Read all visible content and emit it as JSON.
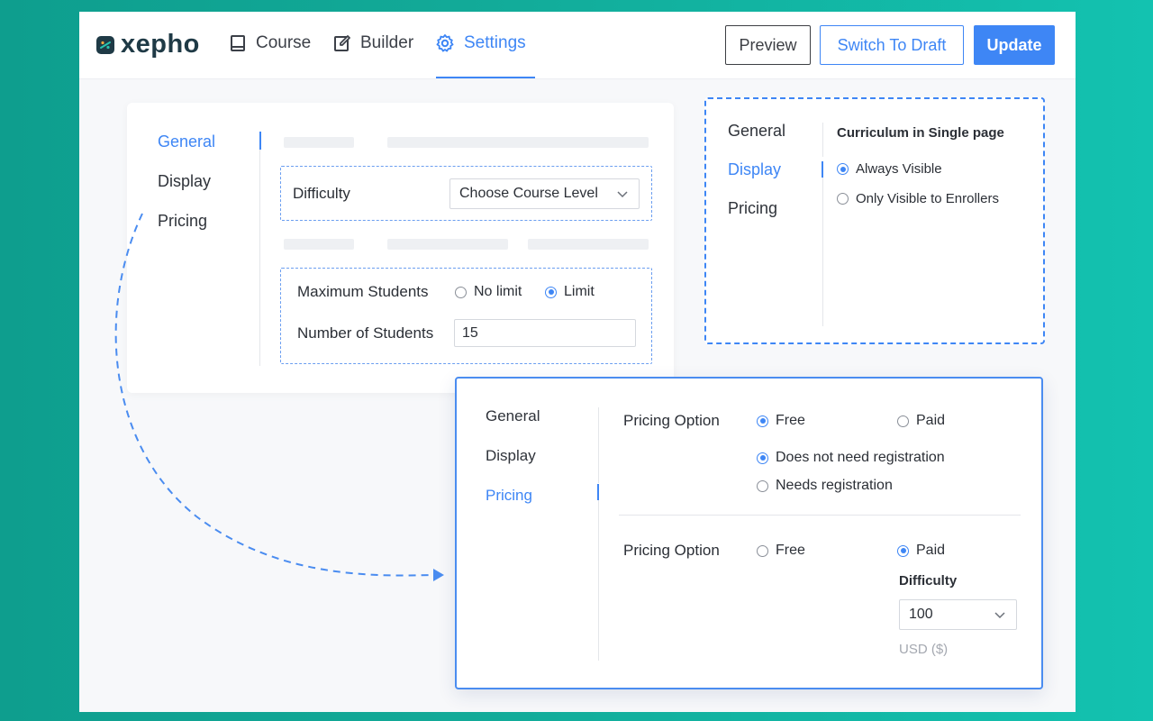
{
  "brand": {
    "name": "xepho"
  },
  "nav": {
    "course": "Course",
    "builder": "Builder",
    "settings": "Settings"
  },
  "actions": {
    "preview": "Preview",
    "switch_to_draft": "Switch To Draft",
    "update": "Update"
  },
  "colors": {
    "accent": "#3e86f5",
    "background": "#13b3a2"
  },
  "tabs": {
    "general": "General",
    "display": "Display",
    "pricing": "Pricing"
  },
  "general_panel": {
    "active_tab": "General",
    "difficulty_label": "Difficulty",
    "difficulty_select": "Choose Course Level",
    "max_students_label": "Maximum Students",
    "no_limit": "No limit",
    "limit": "Limit",
    "max_students_selected": "Limit",
    "num_students_label": "Number of Students",
    "num_students_value": "15"
  },
  "display_panel": {
    "active_tab": "Display",
    "heading": "Curriculum in Single page",
    "always_visible": "Always Visible",
    "only_enrollers": "Only Visible to Enrollers",
    "selected": "Always Visible"
  },
  "pricing_panel": {
    "active_tab": "Pricing",
    "free_block": {
      "label": "Pricing Option",
      "free": "Free",
      "paid": "Paid",
      "selected": "Free",
      "no_registration": "Does not need registration",
      "needs_registration": "Needs registration",
      "registration_selected": "Does not need registration"
    },
    "paid_block": {
      "label": "Pricing Option",
      "free": "Free",
      "paid": "Paid",
      "selected": "Paid",
      "difficulty_label": "Difficulty",
      "price_value": "100",
      "currency": "USD ($)"
    }
  }
}
